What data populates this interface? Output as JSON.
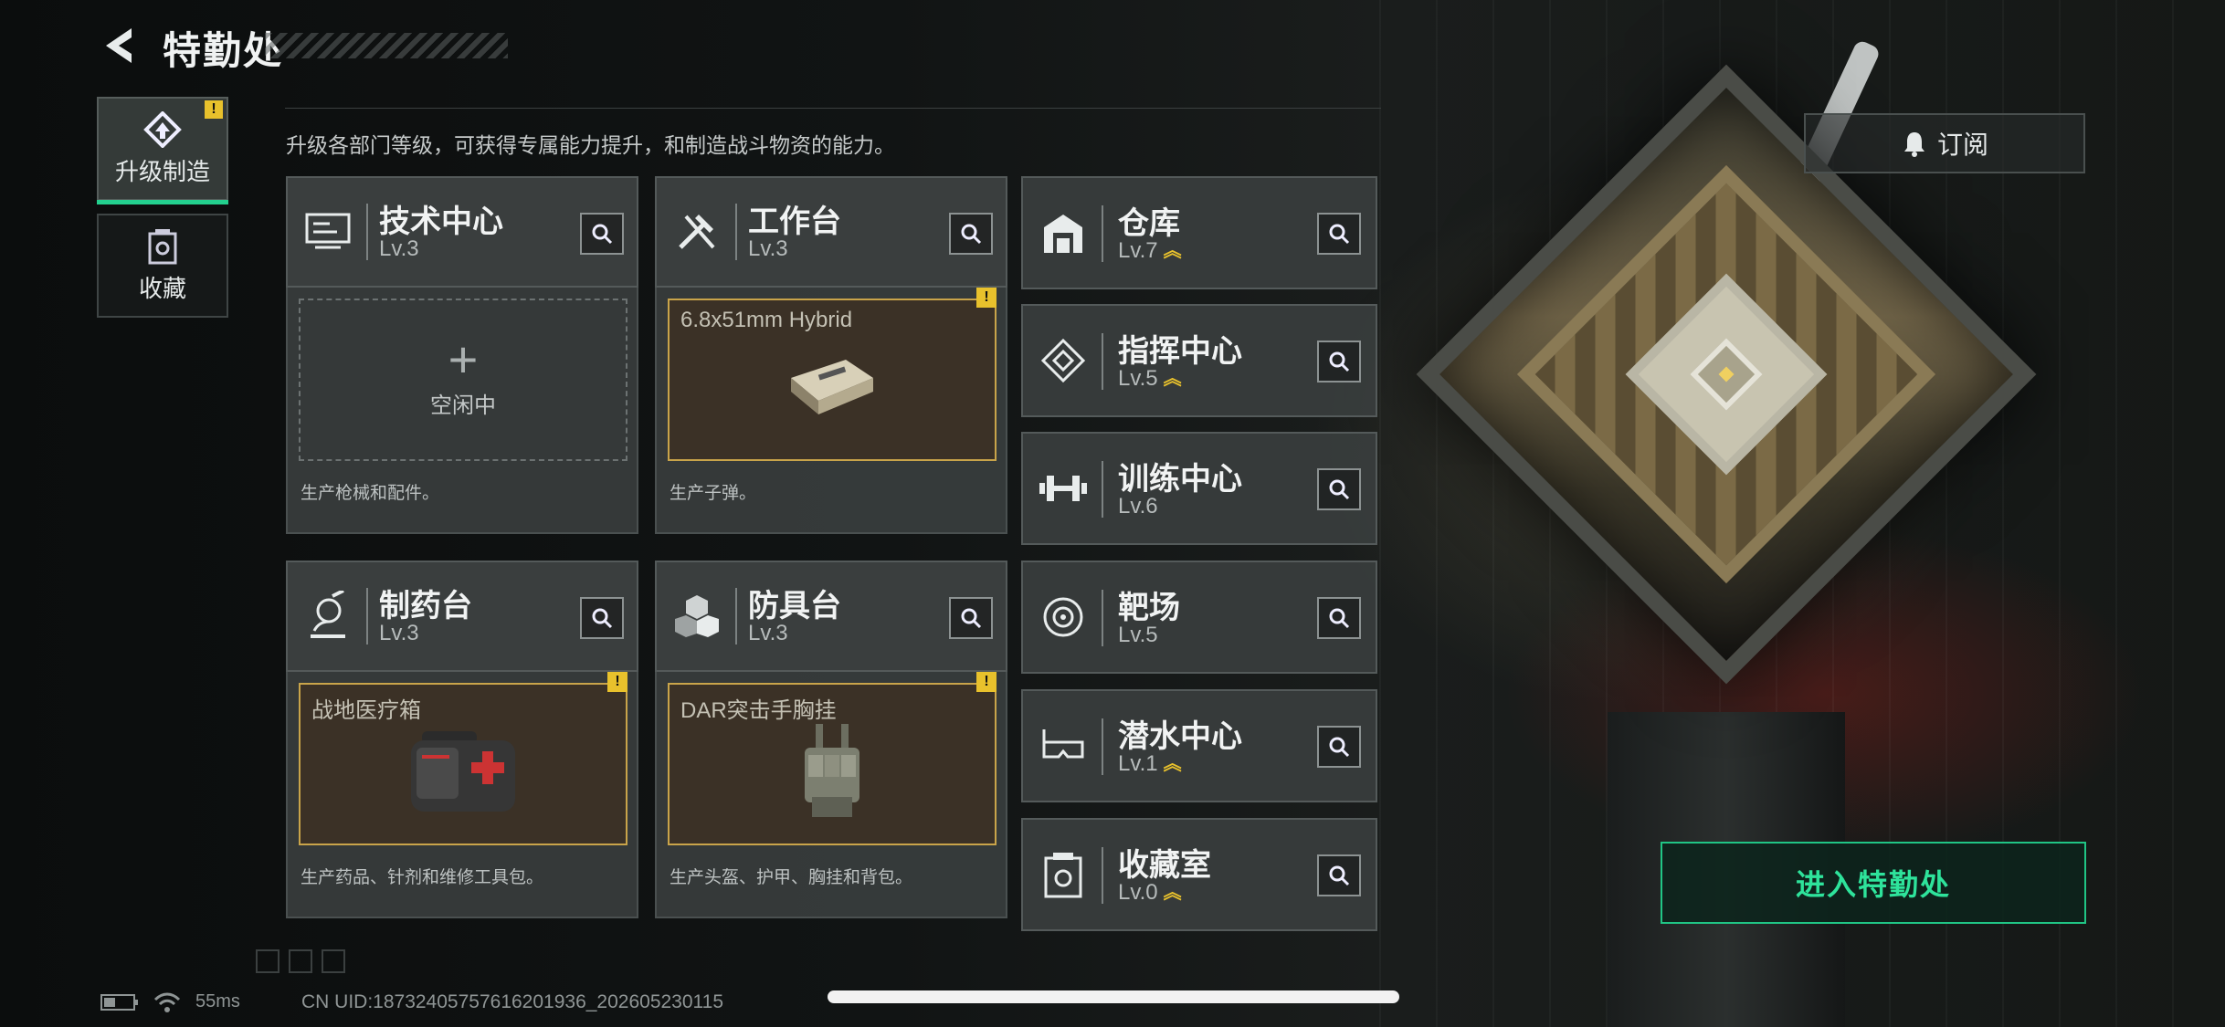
{
  "header": {
    "title": "特勤处"
  },
  "nav": [
    {
      "label": "升级制造",
      "icon": "upgrade-icon",
      "active": true,
      "warn": "!"
    },
    {
      "label": "收藏",
      "icon": "collection-icon",
      "active": false
    }
  ],
  "description": "升级各部门等级，可获得专属能力提升，和制造战斗物资的能力。",
  "subscribe": {
    "label": "订阅",
    "icon": "bell-icon"
  },
  "production_departments": [
    {
      "name": "技术中心",
      "level": "Lv.3",
      "icon": "monitor-icon",
      "status": "idle",
      "idle_text": "空闲中",
      "item": "",
      "description": "生产枪械和配件。"
    },
    {
      "name": "工作台",
      "level": "Lv.3",
      "icon": "tools-icon",
      "status": "producing",
      "item": "6.8x51mm Hybrid",
      "description": "生产子弹。"
    },
    {
      "name": "制药台",
      "level": "Lv.3",
      "icon": "microscope-icon",
      "status": "producing",
      "item": "战地医疗箱",
      "description": "生产药品、针剂和维修工具包。"
    },
    {
      "name": "防具台",
      "level": "Lv.3",
      "icon": "armor-cubes-icon",
      "status": "producing",
      "item": "DAR突击手胸挂",
      "description": "生产头盔、护甲、胸挂和背包。"
    }
  ],
  "facilities": [
    {
      "name": "仓库",
      "level": "Lv.7",
      "icon": "warehouse-icon",
      "upgradable": true
    },
    {
      "name": "指挥中心",
      "level": "Lv.5",
      "icon": "command-icon",
      "upgradable": true
    },
    {
      "name": "训练中心",
      "level": "Lv.6",
      "icon": "dumbbell-icon",
      "upgradable": false
    },
    {
      "name": "靶场",
      "level": "Lv.5",
      "icon": "target-icon",
      "upgradable": false
    },
    {
      "name": "潜水中心",
      "level": "Lv.1",
      "icon": "diving-mask-icon",
      "upgradable": true
    },
    {
      "name": "收藏室",
      "level": "Lv.0",
      "icon": "vault-icon",
      "upgradable": true
    }
  ],
  "enter_button": "进入特勤处",
  "status_bar": {
    "ping": "55ms",
    "uid": "CN UID:18732405757616201936_202605230115"
  },
  "colors": {
    "accent_green": "#23d08e",
    "warning_yellow": "#e8c12c",
    "slot_border_gold": "#c9a44a"
  }
}
